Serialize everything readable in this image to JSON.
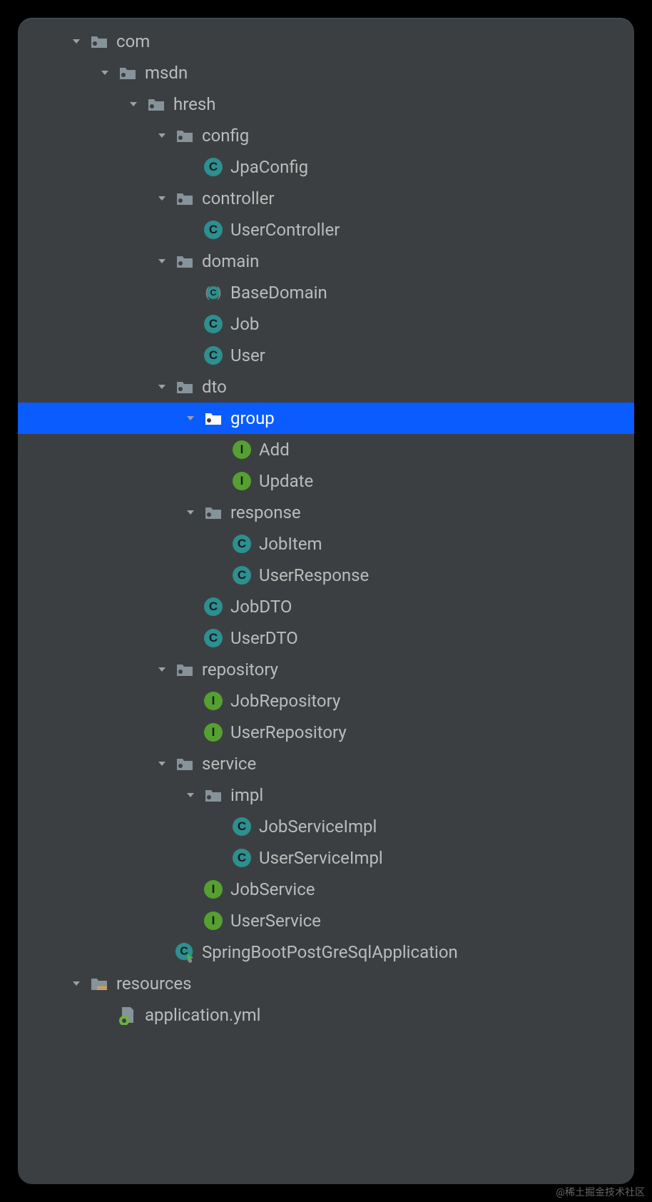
{
  "tree": [
    {
      "depth": 0,
      "expandable": true,
      "iconType": "folder",
      "label": "com",
      "selected": false
    },
    {
      "depth": 1,
      "expandable": true,
      "iconType": "folder",
      "label": "msdn",
      "selected": false
    },
    {
      "depth": 2,
      "expandable": true,
      "iconType": "folder",
      "label": "hresh",
      "selected": false
    },
    {
      "depth": 3,
      "expandable": true,
      "iconType": "folder",
      "label": "config",
      "selected": false
    },
    {
      "depth": 4,
      "expandable": false,
      "iconType": "class",
      "label": "JpaConfig",
      "selected": false
    },
    {
      "depth": 3,
      "expandable": true,
      "iconType": "folder",
      "label": "controller",
      "selected": false
    },
    {
      "depth": 4,
      "expandable": false,
      "iconType": "class",
      "label": "UserController",
      "selected": false
    },
    {
      "depth": 3,
      "expandable": true,
      "iconType": "folder",
      "label": "domain",
      "selected": false
    },
    {
      "depth": 4,
      "expandable": false,
      "iconType": "class-paren",
      "label": "BaseDomain",
      "selected": false
    },
    {
      "depth": 4,
      "expandable": false,
      "iconType": "class",
      "label": "Job",
      "selected": false
    },
    {
      "depth": 4,
      "expandable": false,
      "iconType": "class",
      "label": "User",
      "selected": false
    },
    {
      "depth": 3,
      "expandable": true,
      "iconType": "folder",
      "label": "dto",
      "selected": false
    },
    {
      "depth": 4,
      "expandable": true,
      "iconType": "folder",
      "label": "group",
      "selected": true
    },
    {
      "depth": 5,
      "expandable": false,
      "iconType": "interface",
      "label": "Add",
      "selected": false
    },
    {
      "depth": 5,
      "expandable": false,
      "iconType": "interface",
      "label": "Update",
      "selected": false
    },
    {
      "depth": 4,
      "expandable": true,
      "iconType": "folder",
      "label": "response",
      "selected": false
    },
    {
      "depth": 5,
      "expandable": false,
      "iconType": "class",
      "label": "JobItem",
      "selected": false
    },
    {
      "depth": 5,
      "expandable": false,
      "iconType": "class",
      "label": "UserResponse",
      "selected": false
    },
    {
      "depth": 4,
      "expandable": false,
      "iconType": "class",
      "label": "JobDTO",
      "selected": false
    },
    {
      "depth": 4,
      "expandable": false,
      "iconType": "class",
      "label": "UserDTO",
      "selected": false
    },
    {
      "depth": 3,
      "expandable": true,
      "iconType": "folder",
      "label": "repository",
      "selected": false
    },
    {
      "depth": 4,
      "expandable": false,
      "iconType": "interface",
      "label": "JobRepository",
      "selected": false
    },
    {
      "depth": 4,
      "expandable": false,
      "iconType": "interface",
      "label": "UserRepository",
      "selected": false
    },
    {
      "depth": 3,
      "expandable": true,
      "iconType": "folder",
      "label": "service",
      "selected": false
    },
    {
      "depth": 4,
      "expandable": true,
      "iconType": "folder",
      "label": "impl",
      "selected": false
    },
    {
      "depth": 5,
      "expandable": false,
      "iconType": "class",
      "label": "JobServiceImpl",
      "selected": false
    },
    {
      "depth": 5,
      "expandable": false,
      "iconType": "class",
      "label": "UserServiceImpl",
      "selected": false
    },
    {
      "depth": 4,
      "expandable": false,
      "iconType": "interface",
      "label": "JobService",
      "selected": false
    },
    {
      "depth": 4,
      "expandable": false,
      "iconType": "interface",
      "label": "UserService",
      "selected": false
    },
    {
      "depth": 3,
      "expandable": false,
      "iconType": "class-run",
      "label": "SpringBootPostGreSqlApplication",
      "selected": false
    },
    {
      "depth": 0,
      "expandable": true,
      "iconType": "folder-resources",
      "label": "resources",
      "selected": false
    },
    {
      "depth": 1,
      "expandable": false,
      "iconType": "yml",
      "label": "application.yml",
      "selected": false
    }
  ],
  "watermark": "@稀土掘金技术社区"
}
